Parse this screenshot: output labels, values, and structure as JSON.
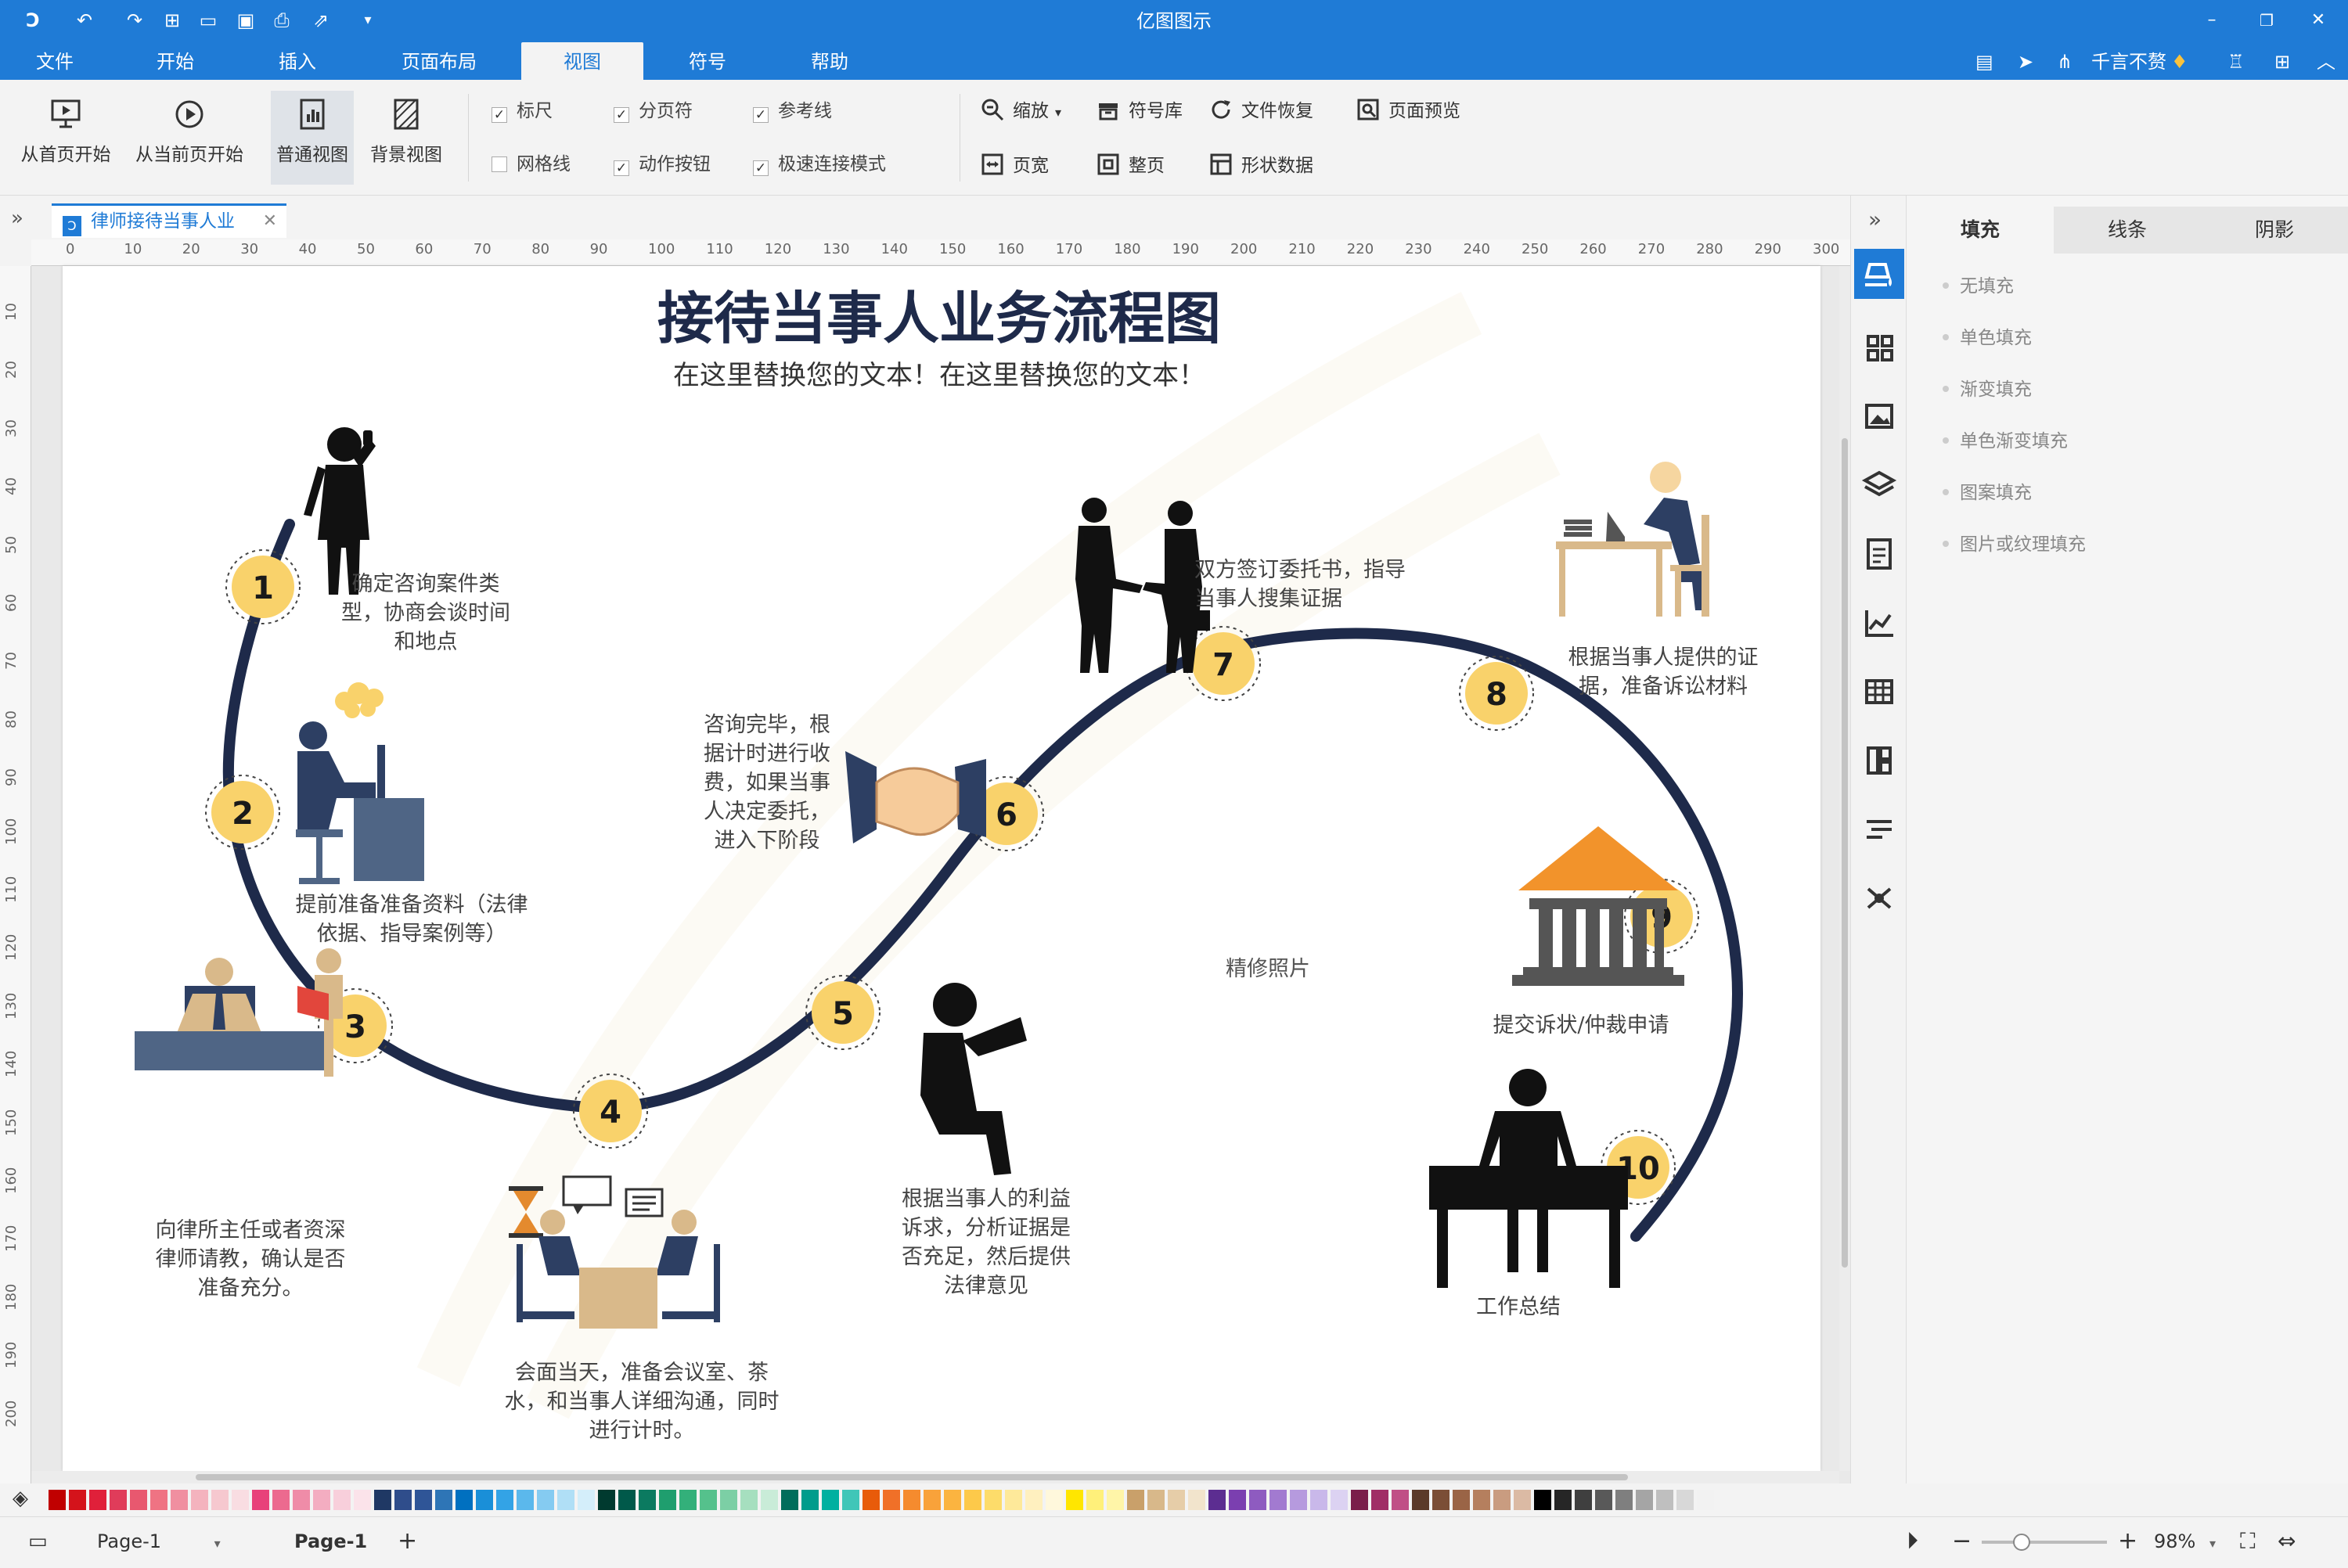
{
  "app": {
    "title": "亿图图示",
    "accent": "#1f7bd6"
  },
  "menu": {
    "items": [
      "文件",
      "开始",
      "插入",
      "页面布局",
      "视图",
      "符号",
      "帮助"
    ],
    "active": "视图",
    "user_name": "千言不赘"
  },
  "ribbon": {
    "big_buttons": [
      "从首页开始",
      "从当前页开始",
      "普通视图",
      "背景视图"
    ],
    "checks": {
      "ruler": {
        "label": "标尺",
        "checked": true
      },
      "page_break": {
        "label": "分页符",
        "checked": true
      },
      "guides": {
        "label": "参考线",
        "checked": true
      },
      "grid": {
        "label": "网格线",
        "checked": false
      },
      "action_button": {
        "label": "动作按钮",
        "checked": true
      },
      "fast_connect": {
        "label": "极速连接模式",
        "checked": true
      }
    },
    "tools": {
      "zoom": "缩放",
      "symbol_lib": "符号库",
      "file_recover": "文件恢复",
      "page_preview": "页面预览",
      "page_width": "页宽",
      "whole_page": "整页",
      "shape_data": "形状数据"
    }
  },
  "document_tab": {
    "name": "律师接待当事人业"
  },
  "rulers": {
    "h_ticks": [
      "0",
      "10",
      "20",
      "30",
      "40",
      "50",
      "60",
      "70",
      "80",
      "90",
      "100",
      "110",
      "120",
      "130",
      "140",
      "150",
      "160",
      "170",
      "180",
      "190",
      "200",
      "210",
      "220",
      "230",
      "240",
      "250",
      "260",
      "270",
      "280",
      "290",
      "300"
    ],
    "v_ticks": [
      "10",
      "20",
      "30",
      "40",
      "50",
      "60",
      "70",
      "80",
      "90",
      "100",
      "110",
      "120",
      "130",
      "140",
      "150",
      "160",
      "170",
      "180",
      "190",
      "200"
    ]
  },
  "diagram": {
    "title": "接待当事人业务流程图",
    "subtitle": "在这里替换您的文本！在这里替换您的文本！",
    "steps": [
      {
        "num": "1",
        "text": "确定咨询案件类型，协商会谈时间和地点"
      },
      {
        "num": "2",
        "text": "提前准备准备资料（法律依据、指导案例等）"
      },
      {
        "num": "3",
        "text": "向律所主任或者资深律师请教，确认是否准备充分。"
      },
      {
        "num": "4",
        "text": "会面当天，准备会议室、茶水，和当事人详细沟通，同时进行计时。"
      },
      {
        "num": "5",
        "text": "根据当事人的利益诉求，分析证据是否充足，然后提供法律意见"
      },
      {
        "num": "6",
        "text": "咨询完毕，根据计时进行收费，如果当事人决定委托，进入下阶段"
      },
      {
        "num": "7",
        "text": "双方签订委托书，指导当事人搜集证据"
      },
      {
        "num": "8",
        "text": "根据当事人提供的证据，准备诉讼材料"
      },
      {
        "num": "9",
        "text": "提交诉状/仲裁申请"
      },
      {
        "num": "10",
        "text": "工作总结"
      }
    ],
    "watermark_text": "精修照片",
    "colors": {
      "path": "#1e2a4a",
      "badge": "#f9d26b",
      "figure": "#111111",
      "roof": "#f2932b",
      "navy": "#2d3f63",
      "slate": "#4f6585",
      "tan": "#d9b98a"
    }
  },
  "right_panel": {
    "tabs": [
      "填充",
      "线条",
      "阴影"
    ],
    "active_tab": "填充",
    "fill_options": [
      "无填充",
      "单色填充",
      "渐变填充",
      "单色渐变填充",
      "图案填充",
      "图片或纹理填充"
    ]
  },
  "palette": {
    "colors": [
      "#c00000",
      "#d4131b",
      "#e0203a",
      "#e03c5a",
      "#e8586f",
      "#ef7383",
      "#f08fa0",
      "#f4b3be",
      "#f6c8cf",
      "#f9dde2",
      "#e8417a",
      "#ec6a8f",
      "#ef8ca8",
      "#f3adc1",
      "#f8cfdb",
      "#fbe3ea",
      "#1f3864",
      "#2f4d8b",
      "#2f5597",
      "#2e75b6",
      "#0070c0",
      "#1a8fd8",
      "#33a3e6",
      "#5bb8ec",
      "#85cbf1",
      "#b0dff6",
      "#d4eefa",
      "#003a2f",
      "#00594a",
      "#0b7a60",
      "#1f9e6e",
      "#33b07a",
      "#55c18c",
      "#7ccfa5",
      "#a6dfbf",
      "#c9ecd8",
      "#006d5b",
      "#009c8c",
      "#00b0a0",
      "#40c6b8",
      "#e85b0a",
      "#f07028",
      "#f58b2e",
      "#f9a23a",
      "#fbb440",
      "#fdc94a",
      "#fddc6a",
      "#fee99a",
      "#fff0bf",
      "#fff8dc",
      "#ffe600",
      "#fff07a",
      "#fff5a8",
      "#c9a06a",
      "#d8b88a",
      "#e6cda8",
      "#f2e4cc",
      "#5c2d91",
      "#7b3fb0",
      "#8e5bc0",
      "#a27ad0",
      "#b69ade",
      "#c9b8ea",
      "#dcd2f2",
      "#7a1e4a",
      "#a02e66",
      "#c04f86",
      "#5b3a29",
      "#7b4e36",
      "#9a6446",
      "#b57f5e",
      "#c99c80",
      "#dbbaa4",
      "#000000",
      "#262626",
      "#3f3f3f",
      "#595959",
      "#7f7f7f",
      "#a5a5a5",
      "#bfbfbf",
      "#d8d8d8",
      "#f2f2f2"
    ]
  },
  "status": {
    "page_selector": "Page-1",
    "active_page": "Page-1",
    "zoom": "98%"
  }
}
